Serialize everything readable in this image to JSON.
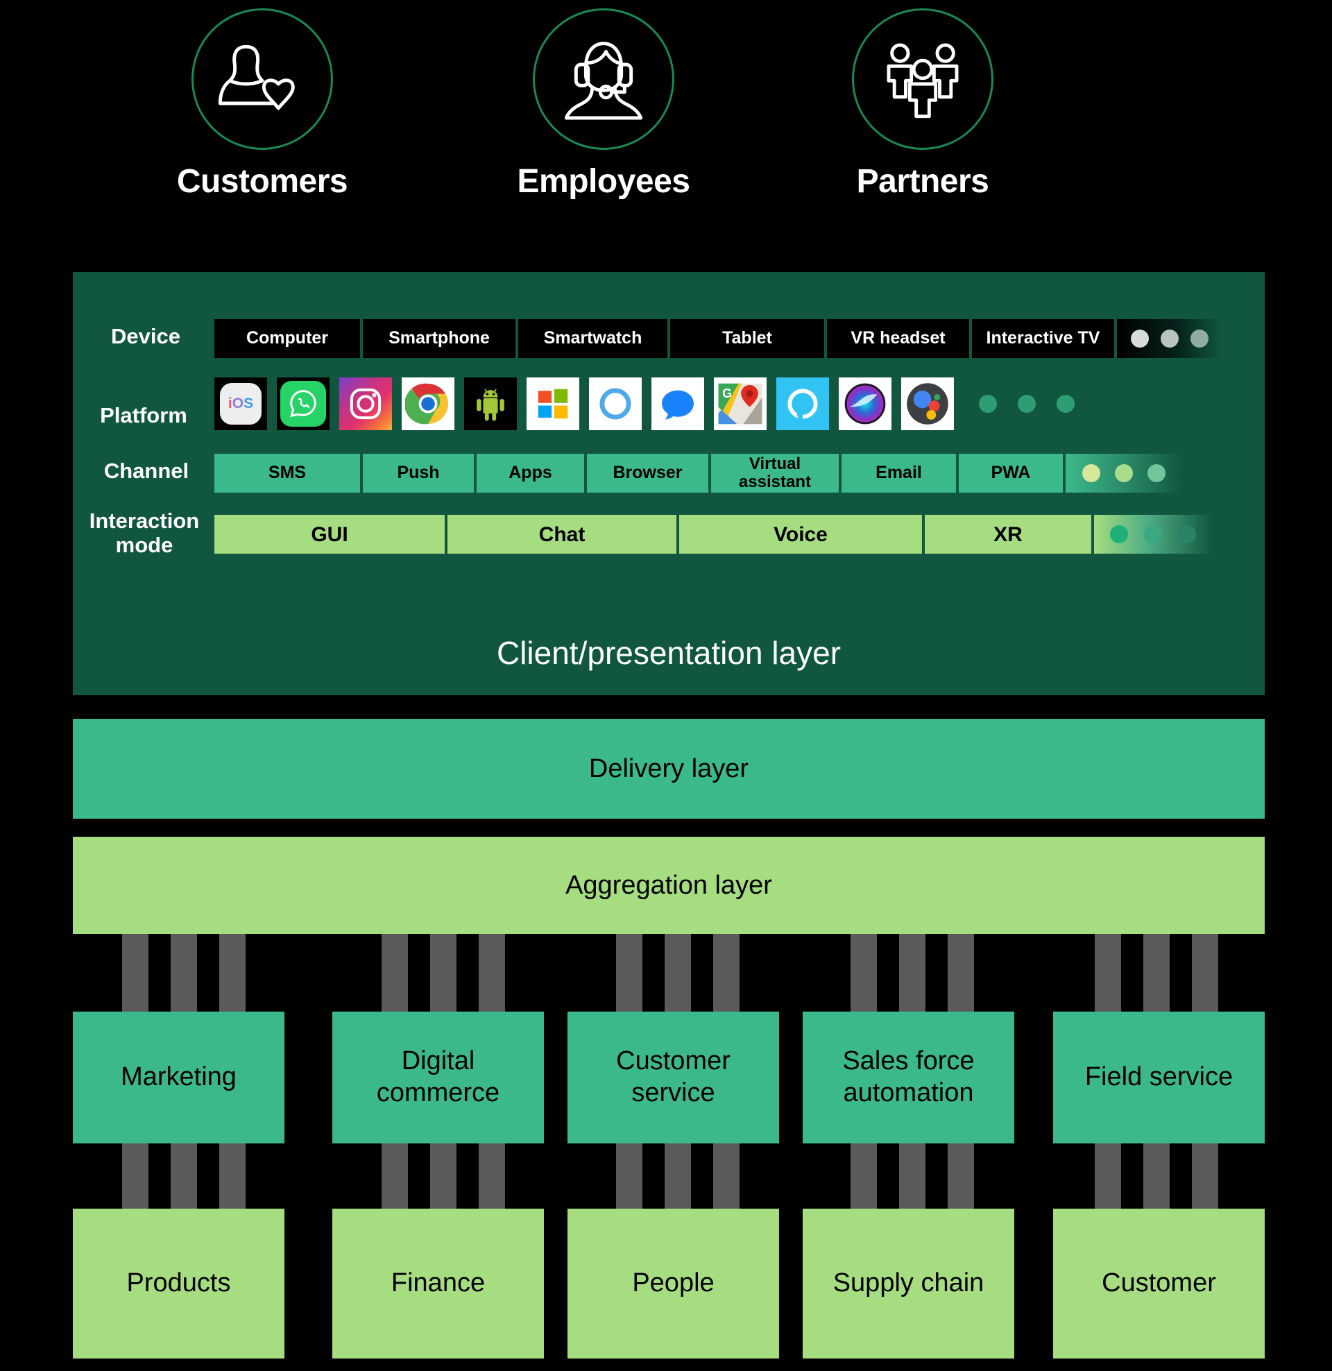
{
  "personas": [
    {
      "label": "Customers",
      "icon": "person-heart-icon"
    },
    {
      "label": "Employees",
      "icon": "headset-agent-icon"
    },
    {
      "label": "Partners",
      "icon": "three-people-icon"
    }
  ],
  "client_panel": {
    "title": "Client/presentation layer",
    "rows": {
      "device": {
        "label": "Device",
        "items": [
          "Computer",
          "Smartphone",
          "Smartwatch",
          "Tablet",
          "VR headset",
          "Interactive TV"
        ],
        "overflow_dots": 3
      },
      "platform": {
        "label": "Platform",
        "items": [
          {
            "name": "ios-icon",
            "title": "iOS"
          },
          {
            "name": "whatsapp-icon",
            "title": "WhatsApp"
          },
          {
            "name": "instagram-icon",
            "title": "Instagram"
          },
          {
            "name": "chrome-icon",
            "title": "Chrome"
          },
          {
            "name": "android-icon",
            "title": "Android"
          },
          {
            "name": "windows-icon",
            "title": "Windows"
          },
          {
            "name": "cortana-icon",
            "title": "Cortana"
          },
          {
            "name": "messages-icon",
            "title": "Messages"
          },
          {
            "name": "google-maps-icon",
            "title": "Google Maps"
          },
          {
            "name": "alexa-icon",
            "title": "Alexa"
          },
          {
            "name": "siri-icon",
            "title": "Siri"
          },
          {
            "name": "google-assistant-icon",
            "title": "Google Assistant"
          }
        ],
        "overflow_dots": 3
      },
      "channel": {
        "label": "Channel",
        "items": [
          "SMS",
          "Push",
          "Apps",
          "Browser",
          "Virtual\nassistant",
          "Email",
          "PWA"
        ],
        "overflow_dots": 3
      },
      "interaction": {
        "label": "Interaction\nmode",
        "items": [
          "GUI",
          "Chat",
          "Voice",
          "XR"
        ],
        "overflow_dots": 3
      }
    }
  },
  "delivery_layer": {
    "label": "Delivery layer"
  },
  "aggregation_layer": {
    "label": "Aggregation layer"
  },
  "service_boxes": [
    "Marketing",
    "Digital\ncommerce",
    "Customer\nservice",
    "Sales force\nautomation",
    "Field service"
  ],
  "data_boxes": [
    "Products",
    "Finance",
    "People",
    "Supply chain",
    "Customer"
  ],
  "colors": {
    "background": "#000000",
    "panel_dark_green": "#115740",
    "mid_green": "#3cb98b",
    "light_green": "#a5dd80",
    "circle_stroke": "#1a8a52",
    "connector_gray": "#5a5a5a",
    "black_chip": "#000000",
    "white": "#ffffff"
  }
}
